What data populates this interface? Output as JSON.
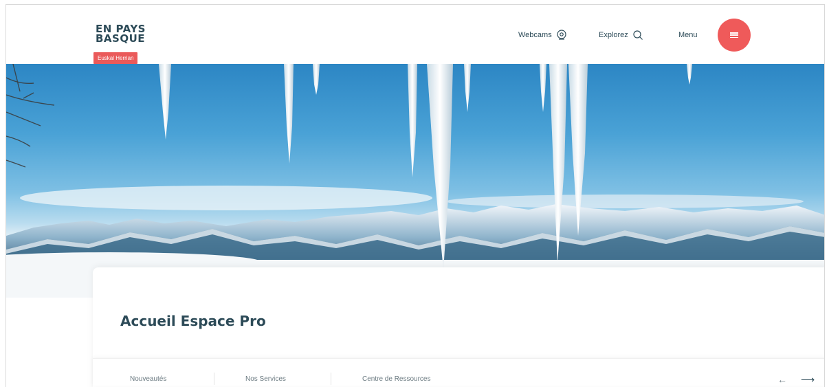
{
  "header": {
    "logo_line1": "EN PAYS",
    "logo_line2": "BASQUE",
    "logo_tag": "Euskal Herrian",
    "nav": {
      "webcams": "Webcams",
      "explorez": "Explorez",
      "menu": "Menu"
    }
  },
  "hero": {
    "image": "mountain-icicles-landscape"
  },
  "main": {
    "title": "Accueil Espace Pro",
    "tabs": [
      {
        "label": "Nouveautés"
      },
      {
        "label": "Nos Services"
      },
      {
        "label": "Centre de Ressources"
      }
    ],
    "arrows": {
      "prev": "←",
      "next": "⟶"
    }
  },
  "colors": {
    "accent": "#ef5a5a",
    "text": "#2d4b58",
    "sky": "#4aa2d6"
  }
}
